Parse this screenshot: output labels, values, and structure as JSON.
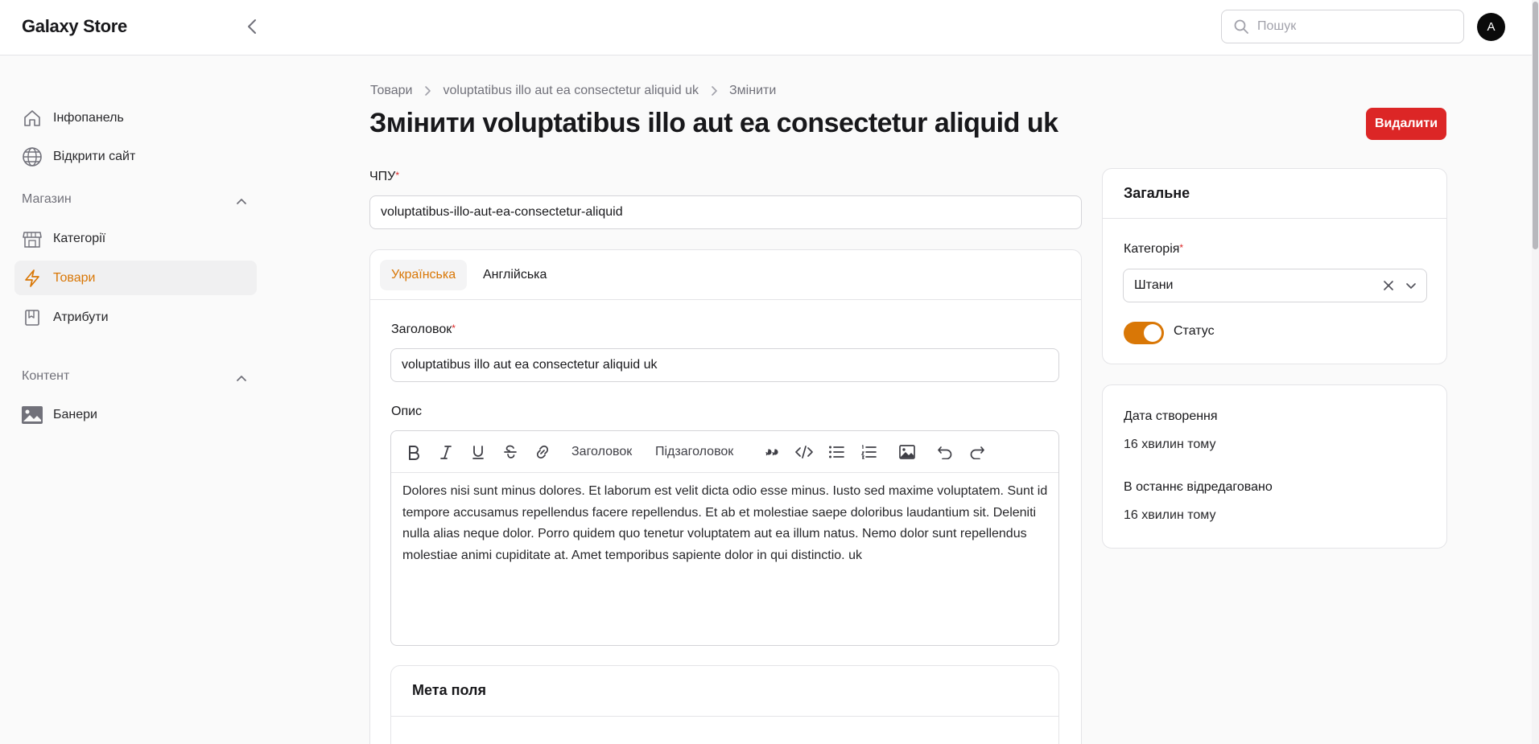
{
  "app": {
    "brand": "Galaxy Store"
  },
  "search": {
    "placeholder": "Пошук"
  },
  "user": {
    "avatar_initial": "A"
  },
  "sidebar": {
    "items_top": [
      {
        "label": "Інфопанель",
        "icon": "home-icon"
      },
      {
        "label": "Відкрити сайт",
        "icon": "globe-icon"
      }
    ],
    "groups": [
      {
        "label": "Магазин",
        "items": [
          {
            "label": "Категорії",
            "icon": "store-icon"
          },
          {
            "label": "Товари",
            "icon": "bolt-icon",
            "active": true
          },
          {
            "label": "Атрибути",
            "icon": "bookmark-icon"
          }
        ]
      },
      {
        "label": "Контент",
        "items": [
          {
            "label": "Банери",
            "icon": "image-icon"
          }
        ]
      }
    ]
  },
  "breadcrumb": [
    "Товари",
    "voluptatibus illo aut ea consectetur aliquid uk",
    "Змінити"
  ],
  "page": {
    "title": "Змінити voluptatibus illo aut ea consectetur aliquid uk",
    "delete_label": "Видалити"
  },
  "form": {
    "slug_label": "ЧПУ",
    "slug_value": "voluptatibus-illo-aut-ea-consectetur-aliquid",
    "tabs": [
      "Українська",
      "Англійська"
    ],
    "active_tab": "Українська",
    "title_label": "Заголовок",
    "title_value": "voluptatibus illo aut ea consectetur aliquid uk",
    "description_label": "Опис",
    "toolbar": {
      "heading_label": "Заголовок",
      "subheading_label": "Підзаголовок"
    },
    "description_text": "Dolores nisi sunt minus dolores. Et laborum est velit dicta odio esse minus. Iusto sed maxime voluptatem. Sunt id tempore accusamus repellendus facere repellendus. Et ab et molestiae saepe doloribus laudantium sit. Deleniti nulla alias neque dolor. Porro quidem quo tenetur voluptatem aut ea illum natus. Nemo dolor sunt repellendus molestiae animi cupiditate at. Amet temporibus sapiente dolor in qui distinctio. uk",
    "meta_title": "Мета поля"
  },
  "general": {
    "title": "Загальне",
    "category_label": "Категорія",
    "category_value": "Штани",
    "status_label": "Статус",
    "status_on": true
  },
  "timestamps": {
    "created_label": "Дата створення",
    "created_value": "16 хвилин тому",
    "updated_label": "В останнє відредаговано",
    "updated_value": "16 хвилин тому"
  },
  "colors": {
    "accent": "#d97706",
    "danger": "#dc2626"
  }
}
